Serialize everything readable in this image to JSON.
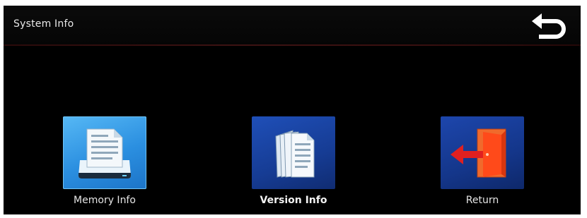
{
  "header": {
    "title": "System Info",
    "back_icon": "back-arrow-icon"
  },
  "menu": {
    "items": [
      {
        "label": "Memory Info",
        "icon": "memory-document-icon",
        "selected": true
      },
      {
        "label": "Version Info",
        "icon": "version-documents-icon",
        "selected": false
      },
      {
        "label": "Return",
        "icon": "exit-door-icon",
        "selected": false
      }
    ]
  },
  "colors": {
    "background": "#000000",
    "selected_tile": "#2b8fe0",
    "tile": "#163c94",
    "divider": "#3d1212",
    "door": "#e8502a",
    "arrow": "#e02020"
  }
}
